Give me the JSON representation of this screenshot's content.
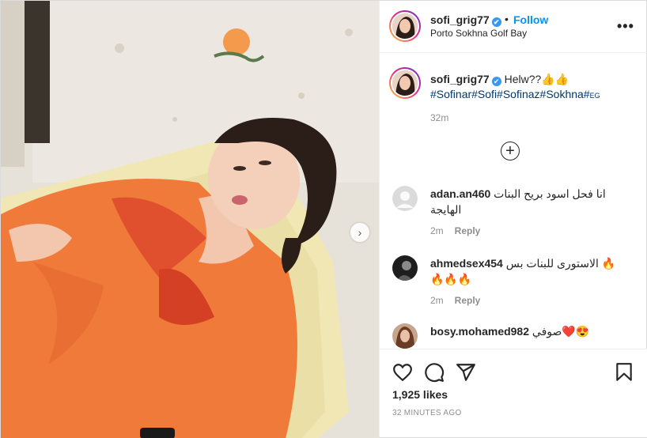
{
  "post": {
    "username": "sofi_grig77",
    "verified_mark": "✔",
    "follow_label": "Follow",
    "separator": "•",
    "location": "Porto Sokhna Golf Bay",
    "more_label": "•••"
  },
  "caption": {
    "username": "sofi_grig77",
    "text": "Helw??👍👍",
    "hashtags": "#Sofinar#Sofi#Sofinaz#Sokhna#",
    "flag": "EG",
    "time": "32m"
  },
  "load_more_label": "+",
  "comments": [
    {
      "username": "adan.an460",
      "text": "انا فحل اسود بريح البنات الهايجة",
      "time": "2m",
      "reply_label": "Reply"
    },
    {
      "username": "ahmedsex454",
      "text": "الاستورى للبنات بس 🔥 🔥🔥🔥",
      "time": "2m",
      "reply_label": "Reply"
    },
    {
      "username": "bosy.mohamed982",
      "text": "صوفي❤️😍"
    }
  ],
  "actions": {
    "icons": [
      "heart-icon",
      "comment-icon",
      "share-icon",
      "bookmark-icon"
    ],
    "likes": "1,925 likes",
    "time_ago": "32 MINUTES AGO"
  },
  "colors": {
    "accent": "#0095f6",
    "hashtag": "#00376b",
    "muted": "#8e8e8e",
    "dress": "#f07a3a"
  }
}
